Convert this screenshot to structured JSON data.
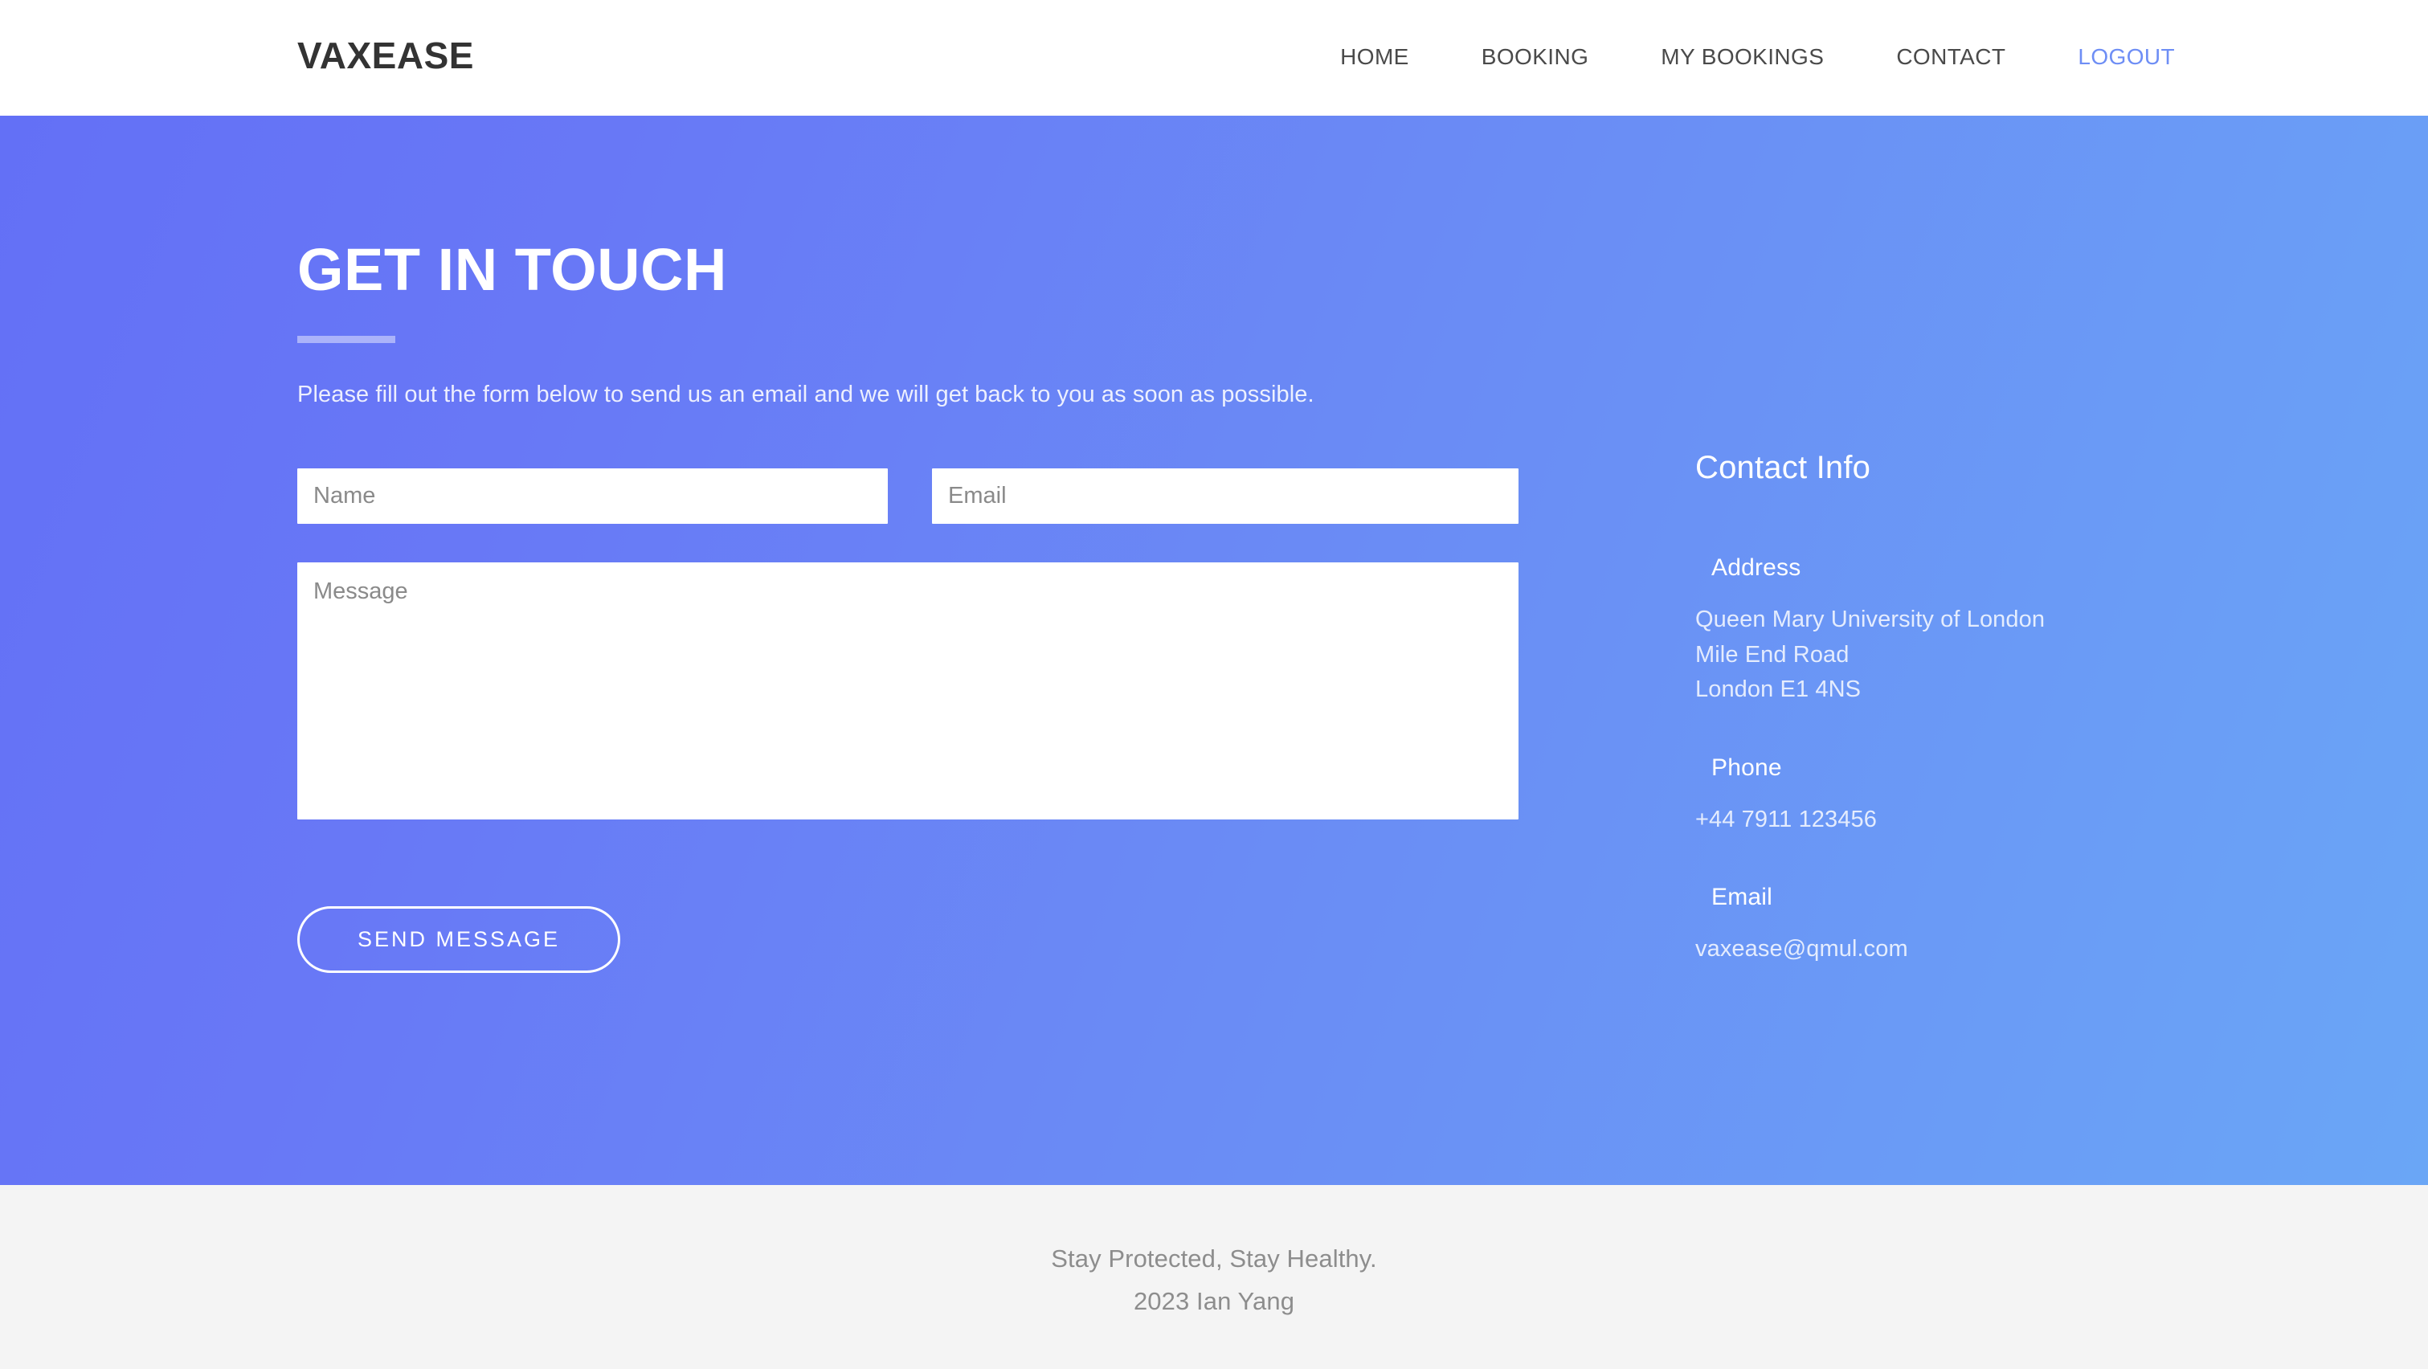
{
  "header": {
    "brand": "VAXEASE",
    "nav": [
      {
        "label": "HOME",
        "accent": false
      },
      {
        "label": "BOOKING",
        "accent": false
      },
      {
        "label": "MY BOOKINGS",
        "accent": false
      },
      {
        "label": "CONTACT",
        "accent": false
      },
      {
        "label": "LOGOUT",
        "accent": true
      }
    ]
  },
  "hero": {
    "title": "GET IN TOUCH",
    "intro": "Please fill out the form below to send us an email and we will get back to you as soon as possible.",
    "form": {
      "name_placeholder": "Name",
      "name_value": "",
      "email_placeholder": "Email",
      "email_value": "",
      "message_placeholder": "Message",
      "message_value": "",
      "submit_label": "SEND MESSAGE"
    },
    "contact_info": {
      "heading": "Contact Info",
      "items": [
        {
          "label": "Address",
          "icon": "map-marker-icon",
          "value": "Queen Mary University of London\nMile End Road\nLondon E1 4NS"
        },
        {
          "label": "Phone",
          "icon": "phone-icon",
          "value": "+44 7911 123456"
        },
        {
          "label": "Email",
          "icon": "envelope-icon",
          "value": "vaxease@qmul.com"
        }
      ]
    }
  },
  "footer": {
    "tagline": "Stay Protected, Stay Healthy.",
    "copyright": "2023 Ian Yang"
  },
  "colors": {
    "gradient_start": "#6370f6",
    "gradient_end": "#6aa6f6",
    "accent_link": "#6e8ef5",
    "footer_background": "#f4f4f4",
    "brand_text": "#333333"
  }
}
